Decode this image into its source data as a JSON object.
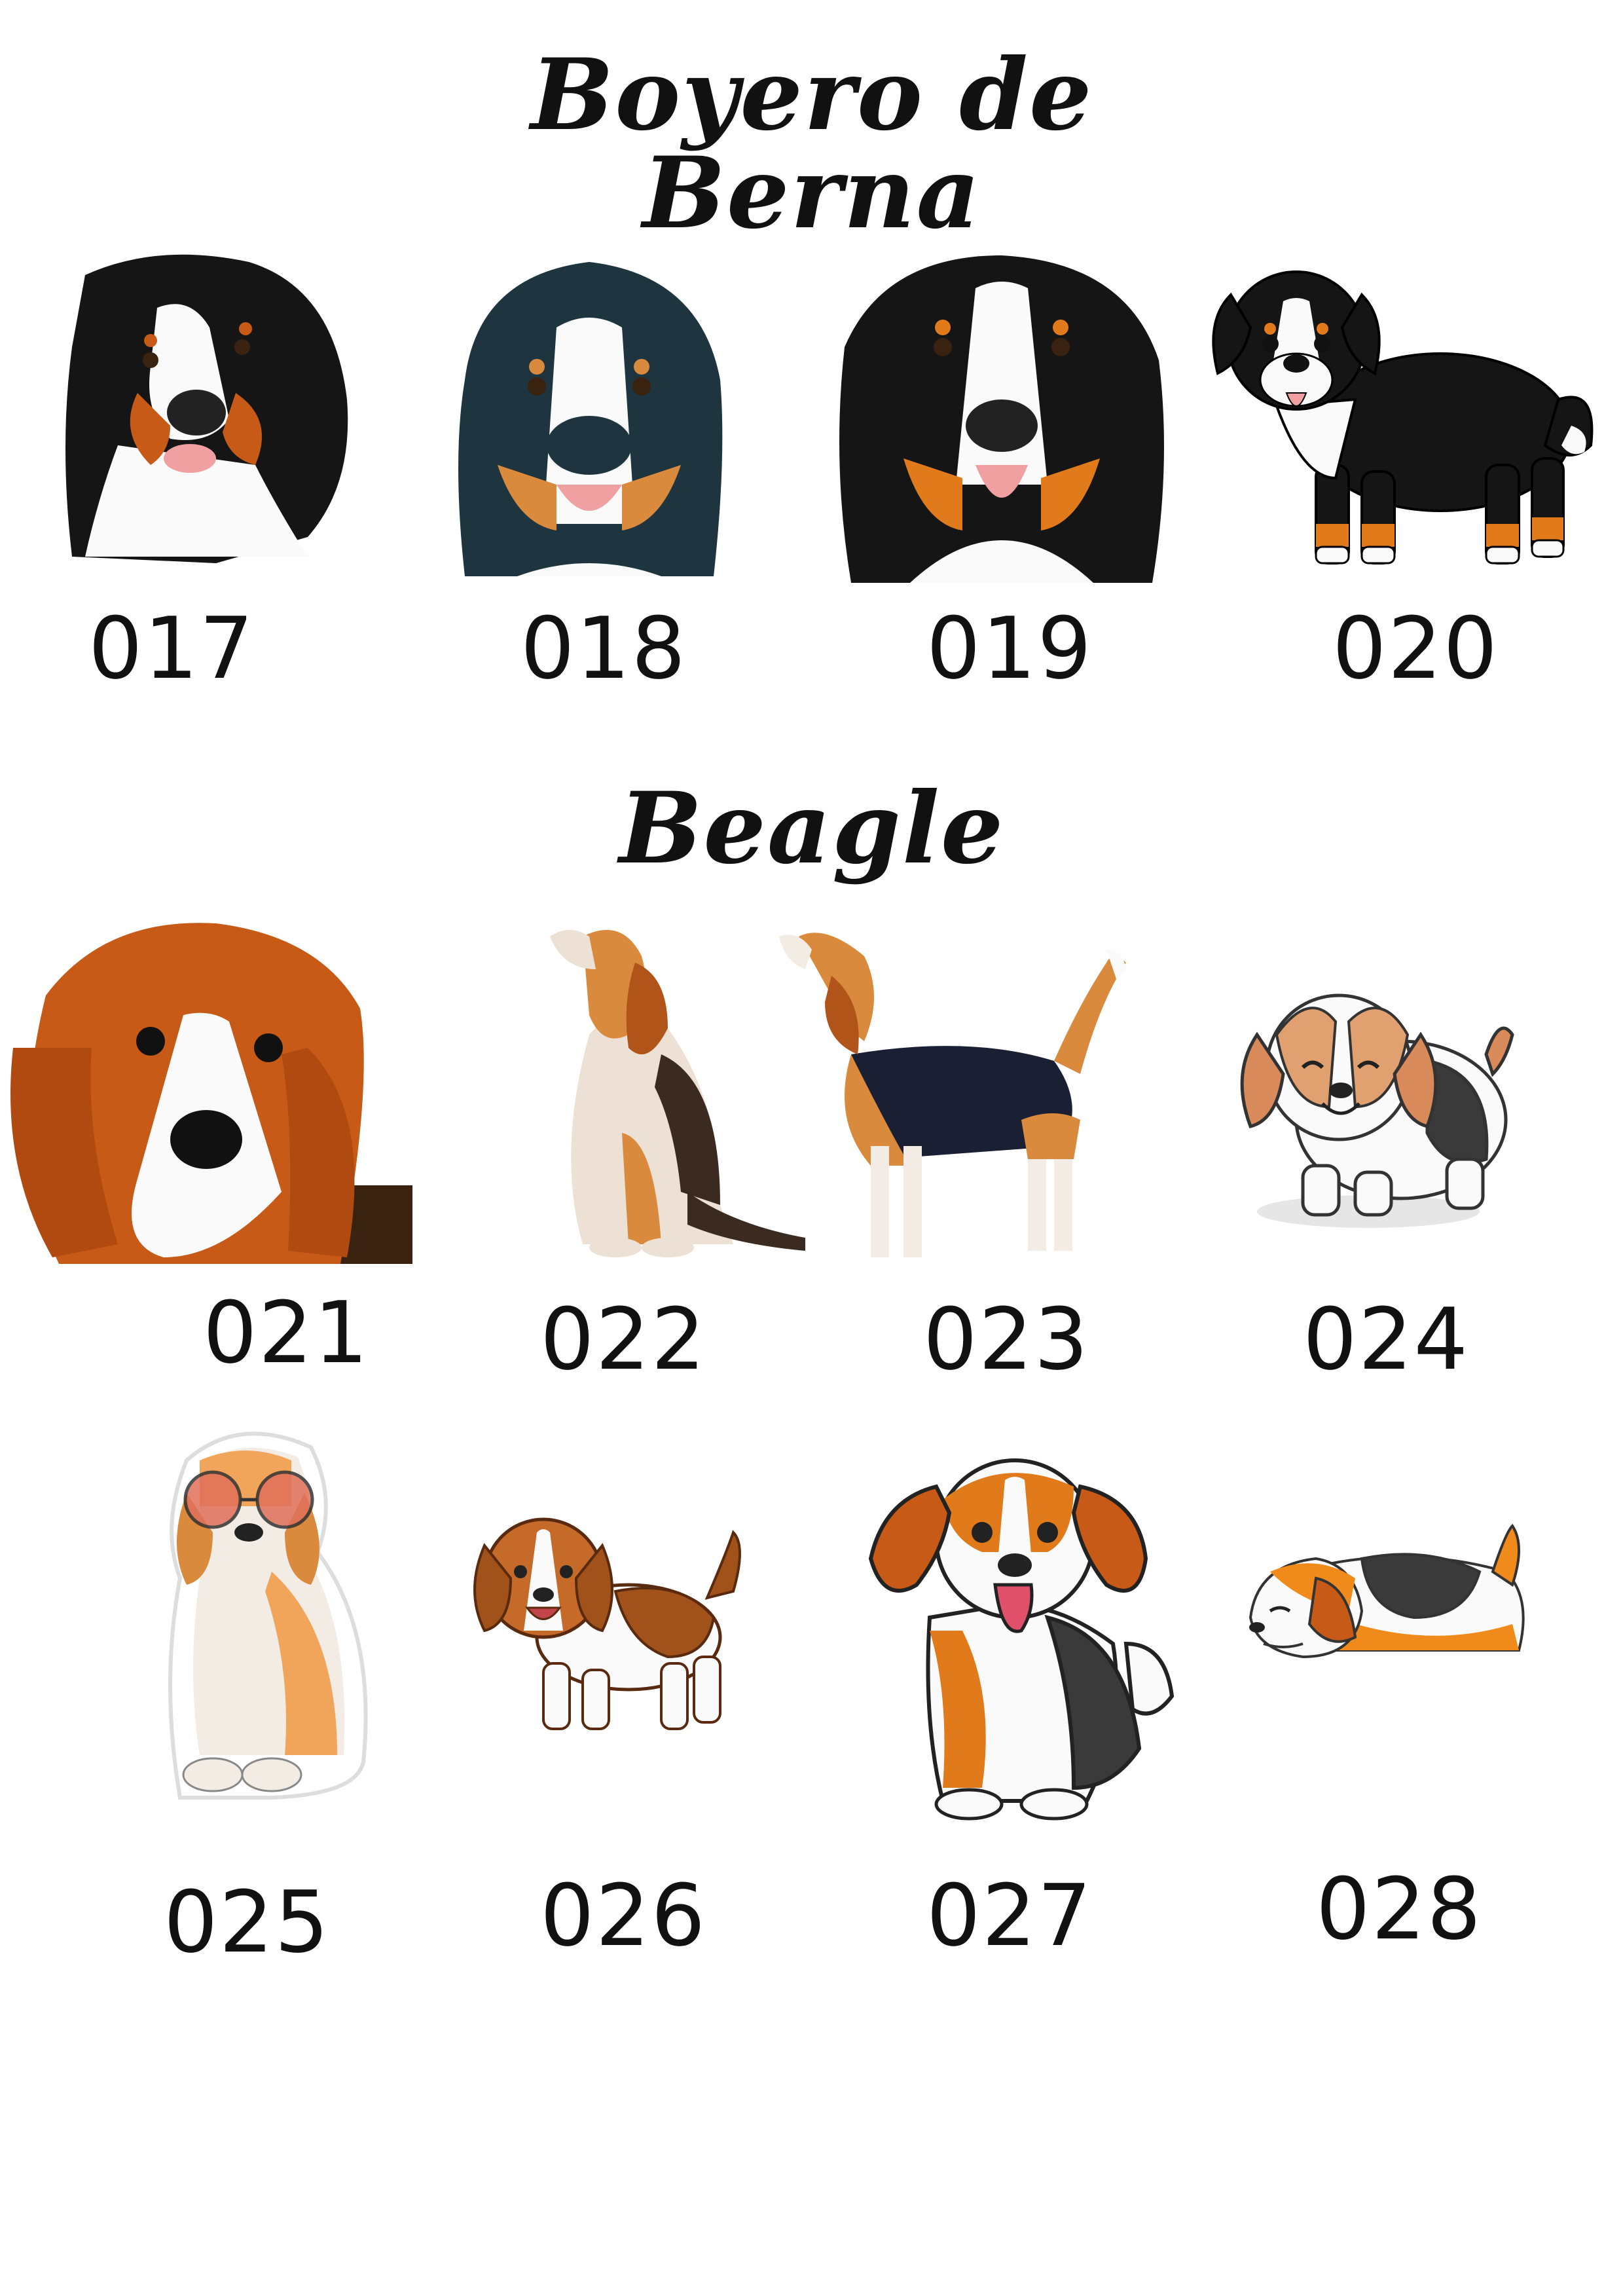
{
  "sections": [
    {
      "title": "Boyero de Berna",
      "items": [
        {
          "code": "017",
          "image": "bernese-portrait-tilted"
        },
        {
          "code": "018",
          "image": "bernese-portrait-smiling"
        },
        {
          "code": "019",
          "image": "bernese-portrait-long-fur"
        },
        {
          "code": "020",
          "image": "bernese-cartoon-standing"
        }
      ]
    },
    {
      "title": "Beagle",
      "items": [
        {
          "code": "021",
          "image": "beagle-portrait"
        },
        {
          "code": "022",
          "image": "beagle-sitting-howling"
        },
        {
          "code": "023",
          "image": "beagle-standing-howling"
        },
        {
          "code": "024",
          "image": "beagle-cartoon-happy"
        },
        {
          "code": "025",
          "image": "beagle-with-sunglasses"
        },
        {
          "code": "026",
          "image": "beagle-cartoon-walking"
        },
        {
          "code": "027",
          "image": "beagle-cartoon-sitting"
        },
        {
          "code": "028",
          "image": "beagle-cartoon-sleeping"
        }
      ]
    }
  ],
  "colors": {
    "black_fur": "#151515",
    "rust": "#c65a16",
    "tan": "#d98a3c",
    "white_fur": "#fafafa",
    "tongue": "#f0a0a0",
    "beagle_orange": "#d97a2a"
  }
}
